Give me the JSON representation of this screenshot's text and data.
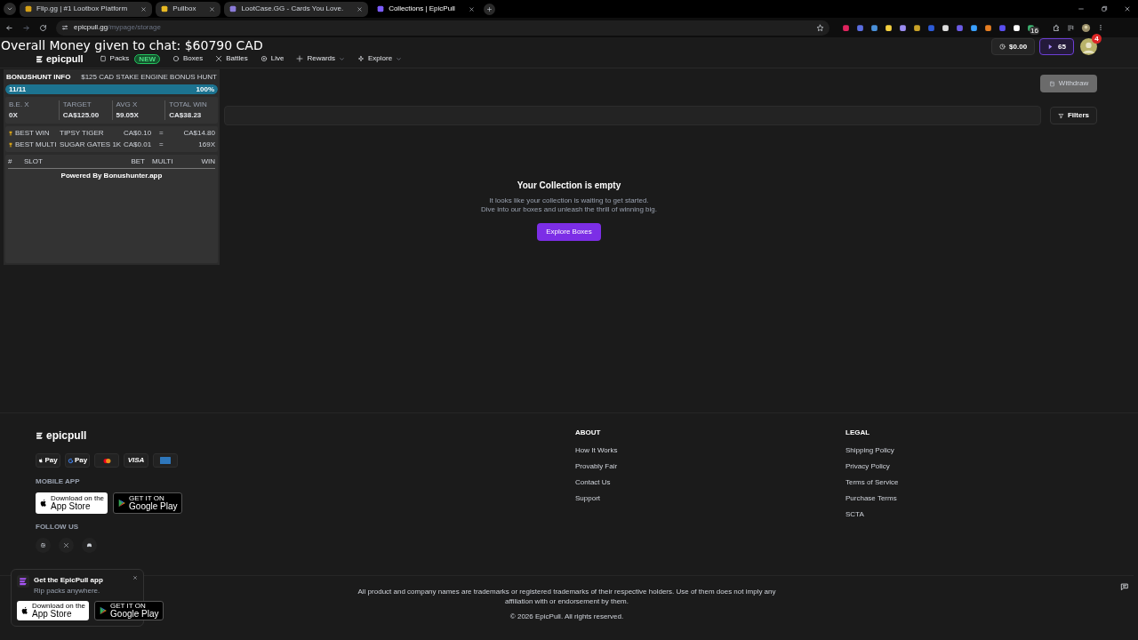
{
  "browser": {
    "tabs": [
      {
        "title": "Flip.gg | #1 Lootbox Platform",
        "selected": false
      },
      {
        "title": "Pullbox",
        "selected": false
      },
      {
        "title": "LootCase.GG - Cards You Love.",
        "selected": false
      },
      {
        "title": "Collections | EpicPull",
        "selected": true
      }
    ],
    "url": {
      "host": "epicpull.gg",
      "path": "/mypage/storage"
    },
    "extension_badge": "16"
  },
  "overlay_caption": "Overall Money given to chat: $60790 CAD",
  "nav": {
    "logo": "epicpull",
    "items": [
      {
        "label": "Packs",
        "badge": "NEW",
        "kind": "plain"
      },
      {
        "label": "Boxes",
        "kind": "plain"
      },
      {
        "label": "Battles",
        "kind": "plain"
      },
      {
        "label": "Live",
        "kind": "plain"
      },
      {
        "label": "Rewards",
        "kind": "dropdown"
      },
      {
        "label": "Explore",
        "kind": "dropdown"
      }
    ],
    "balance": "$0.00",
    "gems": "65",
    "avatar_badge": "4"
  },
  "bonushunt": {
    "title": "BONUSHUNT INFO",
    "hunt_name": "$125 CAD STAKE ENGINE BONUS HUNT",
    "progress": {
      "label": "11/11",
      "percent": "100%",
      "level": 1
    },
    "stats": [
      {
        "label": "B.E. X",
        "value": "0X"
      },
      {
        "label": "TARGET",
        "value": "CA$125.00"
      },
      {
        "label": "AVG X",
        "value": "59.05X"
      },
      {
        "label": "TOTAL WIN",
        "value": "CA$38.23"
      }
    ],
    "bests": [
      {
        "label": "BEST WIN",
        "slot": "TIPSY TIGER",
        "bet": "CA$0.10",
        "sep": "=",
        "result": "CA$14.80"
      },
      {
        "label": "BEST MULTI",
        "slot": "SUGAR GATES 1K",
        "bet": "CA$0.01",
        "sep": "=",
        "result": "169X"
      }
    ],
    "columns": [
      "#",
      "SLOT",
      "BET",
      "MULTI",
      "WIN"
    ],
    "footer": "Powered By Bonushunter.app"
  },
  "page": {
    "withdraw": "Withdraw",
    "filters": "Filters",
    "empty": {
      "title": "Your Collection is empty",
      "lines": [
        "It looks like your collection is waiting to get started.",
        "Dive into our boxes and unleash the thrill of winning big."
      ],
      "button": "Explore Boxes"
    }
  },
  "footer": {
    "logo": "epicpull",
    "payments": [
      {
        "kind": "apple",
        "label": "Pay"
      },
      {
        "kind": "google",
        "label": "Pay"
      },
      {
        "kind": "mastercard"
      },
      {
        "kind": "visa",
        "label": "VISA"
      },
      {
        "kind": "amex"
      }
    ],
    "mobile_heading": "MOBILE APP",
    "stores": [
      {
        "kind": "apple",
        "small": "Download on the",
        "big": "App Store"
      },
      {
        "kind": "google",
        "small": "GET IT ON",
        "big": "Google Play"
      }
    ],
    "follow_heading": "FOLLOW US",
    "socials": [
      {
        "kind": "instagram"
      },
      {
        "kind": "x"
      },
      {
        "kind": "discord"
      }
    ],
    "columns": [
      {
        "heading": "ABOUT",
        "links": [
          "How It Works",
          "Provably Fair",
          "Contact Us",
          "Support"
        ]
      },
      {
        "heading": "LEGAL",
        "links": [
          "Shipping Policy",
          "Privacy Policy",
          "Terms of Service",
          "Purchase Terms",
          "SCTA"
        ]
      }
    ],
    "disclaimer": "All product and company names are trademarks or registered trademarks of their respective holders. Use of them does not imply any affiliation with or endorsement by them.",
    "copyright": "© 2026 EpicPull. All rights reserved."
  },
  "app_popup": {
    "title": "Get the EpicPull app",
    "subtitle": "Rip packs anywhere.",
    "stores": [
      {
        "kind": "apple",
        "small": "Download on the",
        "big": "App Store"
      },
      {
        "kind": "google",
        "small": "GET IT ON",
        "big": "Google Play"
      }
    ]
  }
}
